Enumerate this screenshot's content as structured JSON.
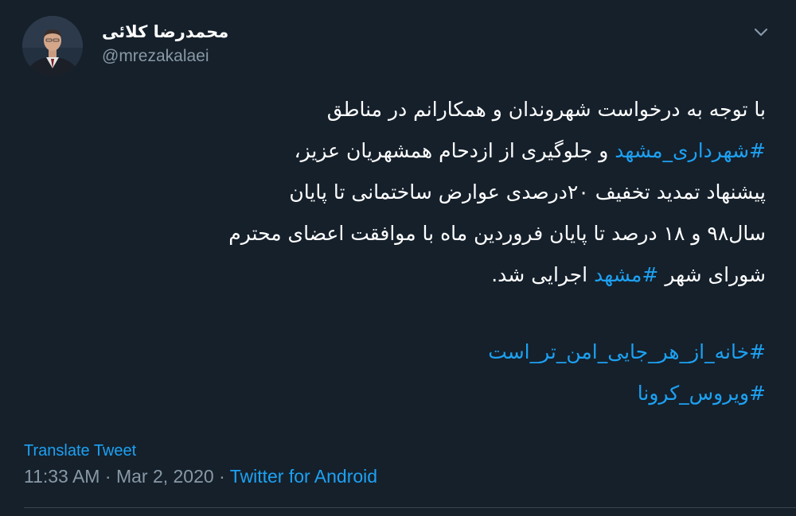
{
  "user": {
    "display_name": "محمدرضا کلائی",
    "handle": "@mrezakalaei"
  },
  "tweet": {
    "lines": [
      [
        {
          "text": "با توجه به درخواست شهروندان و همکارانم در مناطق",
          "hashtag": false
        }
      ],
      [
        {
          "text": "#شهرداری_مشهد",
          "hashtag": true
        },
        {
          "text": " و جلوگیری از ازدحام همشهریان عزیز،",
          "hashtag": false
        }
      ],
      [
        {
          "text": "پیشنهاد تمدید تخفیف ۲۰درصدی عوارض ساختمانی تا پایان",
          "hashtag": false
        }
      ],
      [
        {
          "text": "سال۹۸ و ۱۸ درصد تا پایان فروردین ماه با موافقت اعضای محترم",
          "hashtag": false
        }
      ],
      [
        {
          "text": "شورای شهر ",
          "hashtag": false
        },
        {
          "text": "#مشهد",
          "hashtag": true
        },
        {
          "text": " اجرایی شد.",
          "hashtag": false
        }
      ]
    ],
    "hashtag_lines": [
      "#خانه_از_هر_جایی_امن_تر_است",
      "#ویروس_کرونا"
    ],
    "translate_label": "Translate Tweet",
    "time": "11:33 AM",
    "separator": " · ",
    "date": "Mar 2, 2020",
    "source": "Twitter for Android"
  },
  "icons": {
    "more": "chevron-down-icon",
    "avatar": "avatar"
  },
  "colors": {
    "background": "#15202b",
    "text": "#ffffff",
    "secondary": "#8899a6",
    "accent": "#1da1f2",
    "divider": "#38444d"
  }
}
